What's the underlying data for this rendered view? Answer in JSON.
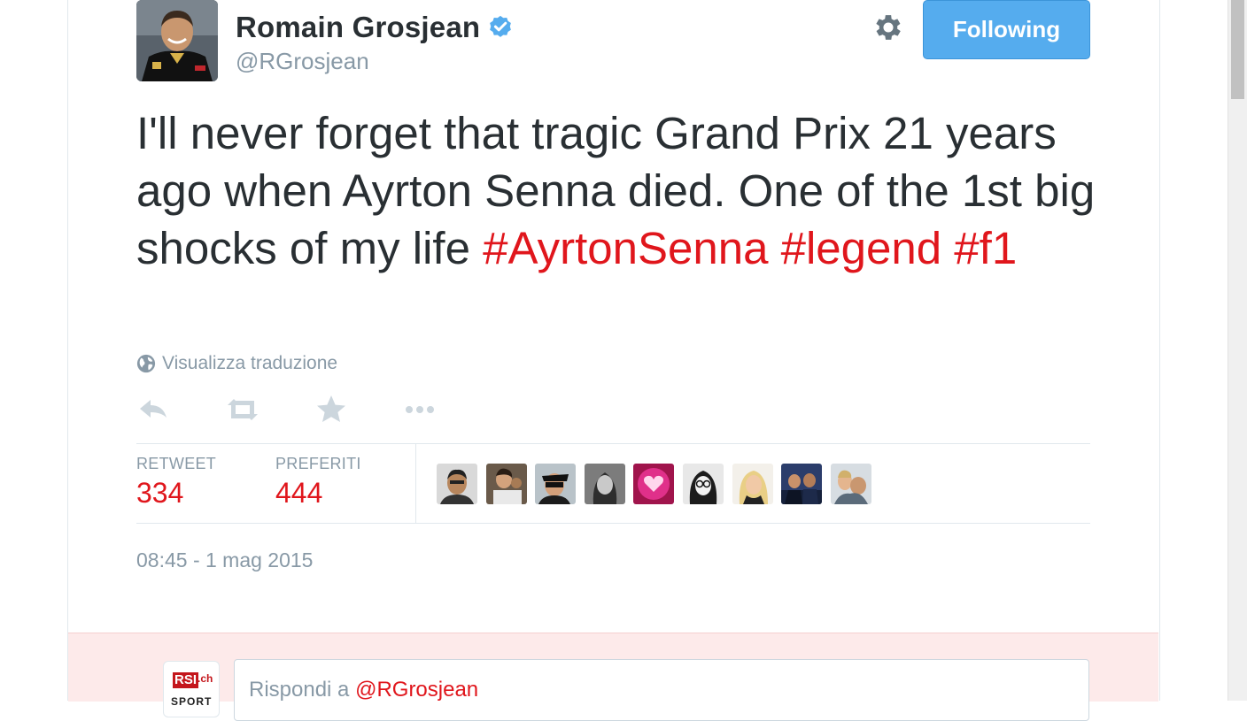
{
  "user": {
    "full_name": "Romain Grosjean",
    "handle": "@RGrosjean",
    "verified": true,
    "follow_button_label": "Following"
  },
  "tweet": {
    "text_plain": "I'll never forget that tragic Grand Prix 21 years ago when Ayrton Senna died. One of the 1st big shocks of my life",
    "hashtags": [
      "#AyrtonSenna",
      "#legend",
      "#f1"
    ],
    "translate_label": "Visualizza traduzione",
    "timestamp": "08:45 - 1 mag 2015"
  },
  "actions": [
    {
      "name": "reply",
      "icon": "reply-icon"
    },
    {
      "name": "retweet",
      "icon": "retweet-icon"
    },
    {
      "name": "favorite",
      "icon": "star-icon"
    },
    {
      "name": "more",
      "icon": "more-icon"
    }
  ],
  "stats": {
    "retweet_label": "RETWEET",
    "retweet_count": "334",
    "favorites_label": "PREFERITI",
    "favorites_count": "444"
  },
  "favorited_by_count_shown": 9,
  "reply": {
    "account_logo_text": "RSI",
    "account_logo_suffix": ".ch",
    "account_logo_sub": "SPORT",
    "prompt_prefix": "Rispondi a",
    "prompt_mention": "@RGrosjean"
  },
  "colors": {
    "accent": "#e0161c",
    "follow_button": "#55acee",
    "verified": "#55acee",
    "muted_text": "#8899a6",
    "reply_area_bg": "#fdeaea"
  }
}
